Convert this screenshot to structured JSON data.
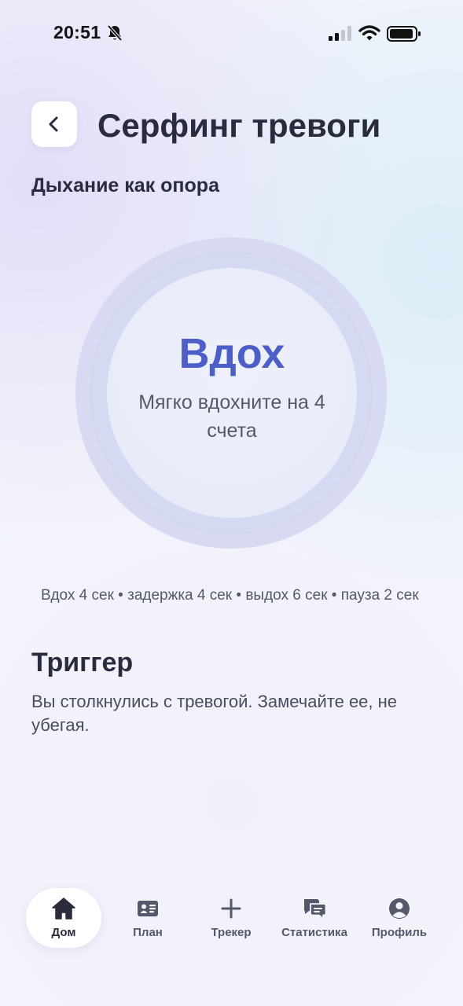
{
  "status_bar": {
    "time": "20:51",
    "icons": [
      "bell-slash-icon",
      "signal-icon",
      "wifi-icon",
      "battery-icon"
    ]
  },
  "header": {
    "back_icon": "chevron-left-icon",
    "title": "Серфинг тревоги"
  },
  "section": {
    "subtitle": "Дыхание как опора"
  },
  "breathing": {
    "phase": "Вдох",
    "instruction": "Мягко вдохните на 4 счета",
    "rhythm": "Вдох 4 сек • задержка 4 сек • выдох 6 сек • пауза 2 сек"
  },
  "trigger": {
    "heading": "Триггер",
    "text": "Вы столкнулись с тревогой. Замечайте ее, не убегая."
  },
  "nav": {
    "items": [
      {
        "label": "Дом",
        "icon": "home-icon",
        "active": true
      },
      {
        "label": "План",
        "icon": "id-card-icon",
        "active": false
      },
      {
        "label": "Трекер",
        "icon": "plus-icon",
        "active": false
      },
      {
        "label": "Статистика",
        "icon": "chat-bubbles-icon",
        "active": false
      },
      {
        "label": "Профиль",
        "icon": "user-circle-icon",
        "active": false
      }
    ]
  },
  "colors": {
    "accent": "#4b5fc6",
    "text_primary": "#2a2c3e",
    "text_secondary": "#55586a",
    "background": "#f3f4fb"
  }
}
